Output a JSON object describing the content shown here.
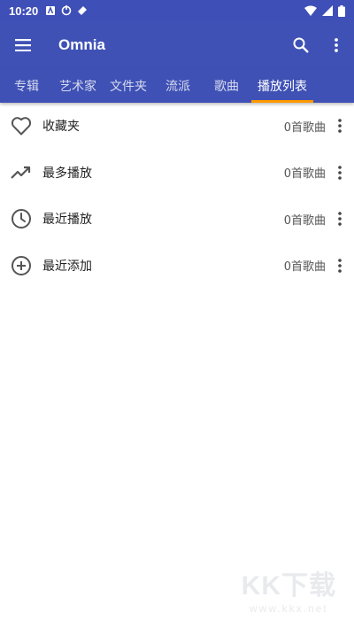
{
  "status_bar": {
    "time": "10:20"
  },
  "app_bar": {
    "title": "Omnia"
  },
  "tabs": [
    {
      "label": "专辑"
    },
    {
      "label": "艺术家"
    },
    {
      "label": "文件夹"
    },
    {
      "label": "流派"
    },
    {
      "label": "歌曲"
    },
    {
      "label": "播放列表",
      "active": true
    }
  ],
  "playlists": [
    {
      "icon": "heart-icon",
      "label": "收藏夹",
      "count": "0首歌曲"
    },
    {
      "icon": "trending-up-icon",
      "label": "最多播放",
      "count": "0首歌曲"
    },
    {
      "icon": "clock-icon",
      "label": "最近播放",
      "count": "0首歌曲"
    },
    {
      "icon": "add-circle-icon",
      "label": "最近添加",
      "count": "0首歌曲"
    }
  ],
  "watermark": {
    "big": "KK下载",
    "small": "www.kkx.net"
  },
  "colors": {
    "primary": "#3f51b5",
    "indicator": "#ff9800",
    "icon": "#555555"
  }
}
